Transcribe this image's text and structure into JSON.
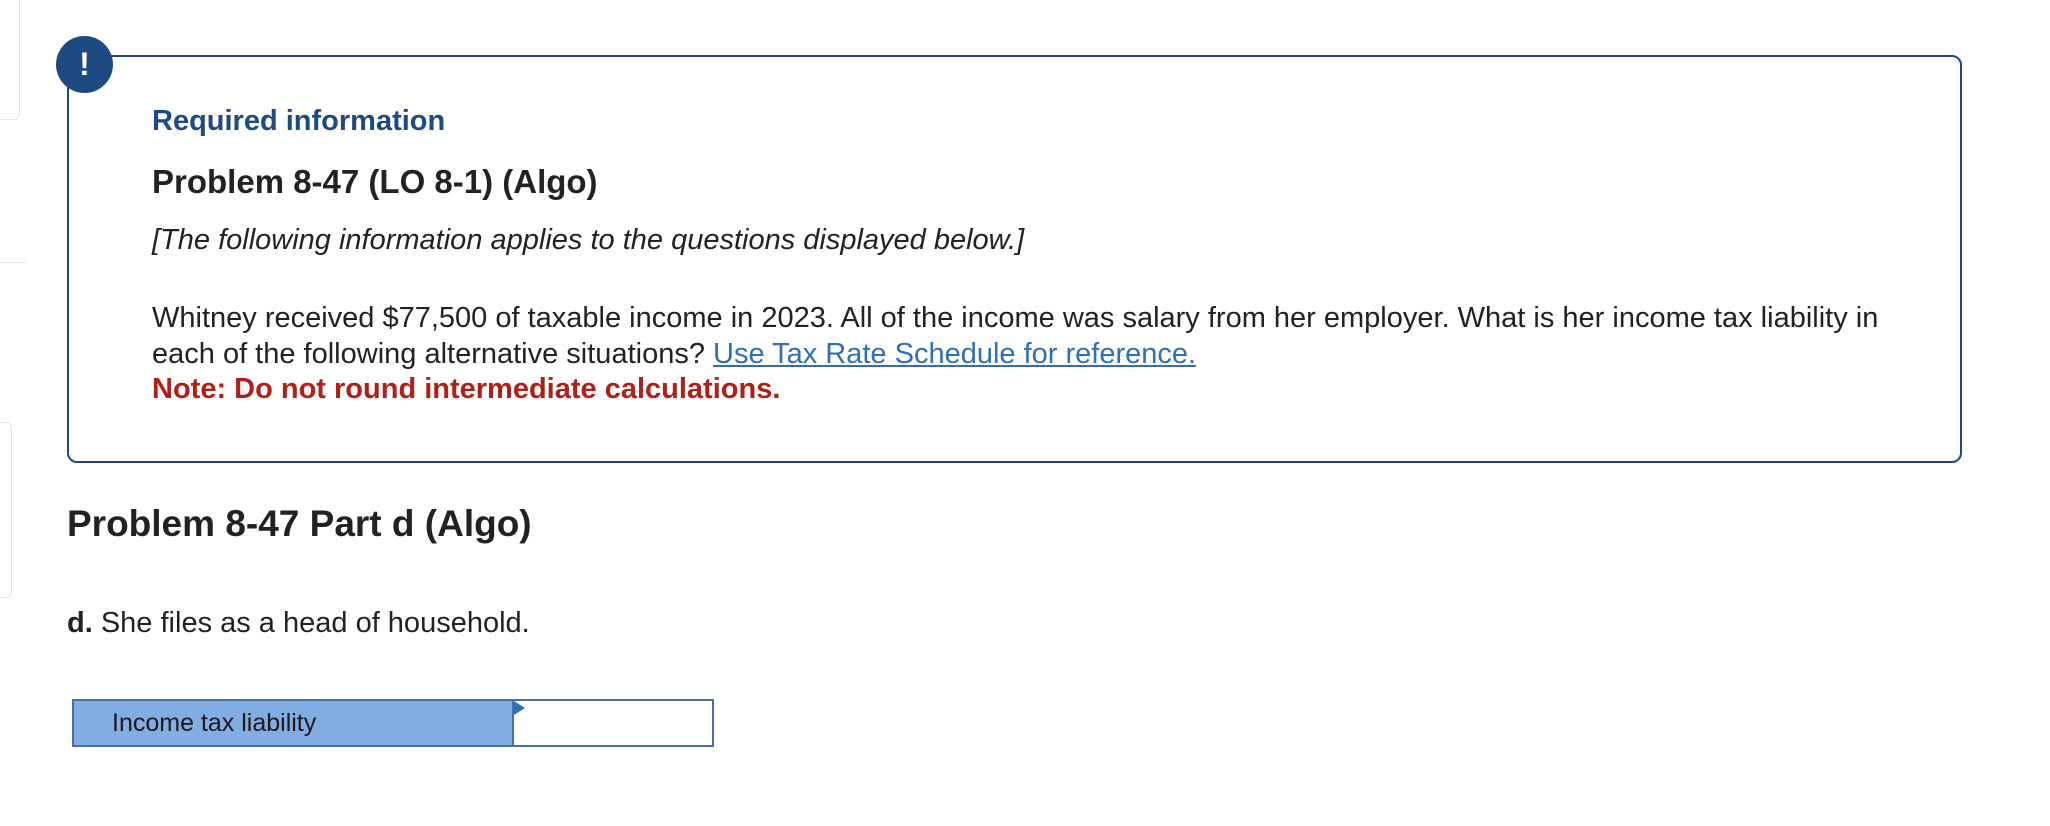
{
  "info_box": {
    "badge": "!",
    "required_title": "Required information",
    "problem_title": "Problem 8-47 (LO 8-1) (Algo)",
    "applies_note": "[The following information applies to the questions displayed below.]",
    "body_text": "Whitney received $77,500 of taxable income in 2023. All of the income was salary from her employer. What is her income tax liability in each of the following alternative situations? ",
    "link_text": "Use Tax Rate Schedule for reference.",
    "note": "Note: Do not round intermediate calculations."
  },
  "part": {
    "heading": "Problem 8-47 Part d (Algo)",
    "question_letter": "d.",
    "question_text": " She files as a head of household."
  },
  "answer_table": {
    "label": "Income tax liability",
    "value": ""
  },
  "colors": {
    "accent_blue": "#1d4a80",
    "link_blue": "#2f6fb5",
    "note_red": "#b02018",
    "label_cell": "#82ade2"
  }
}
